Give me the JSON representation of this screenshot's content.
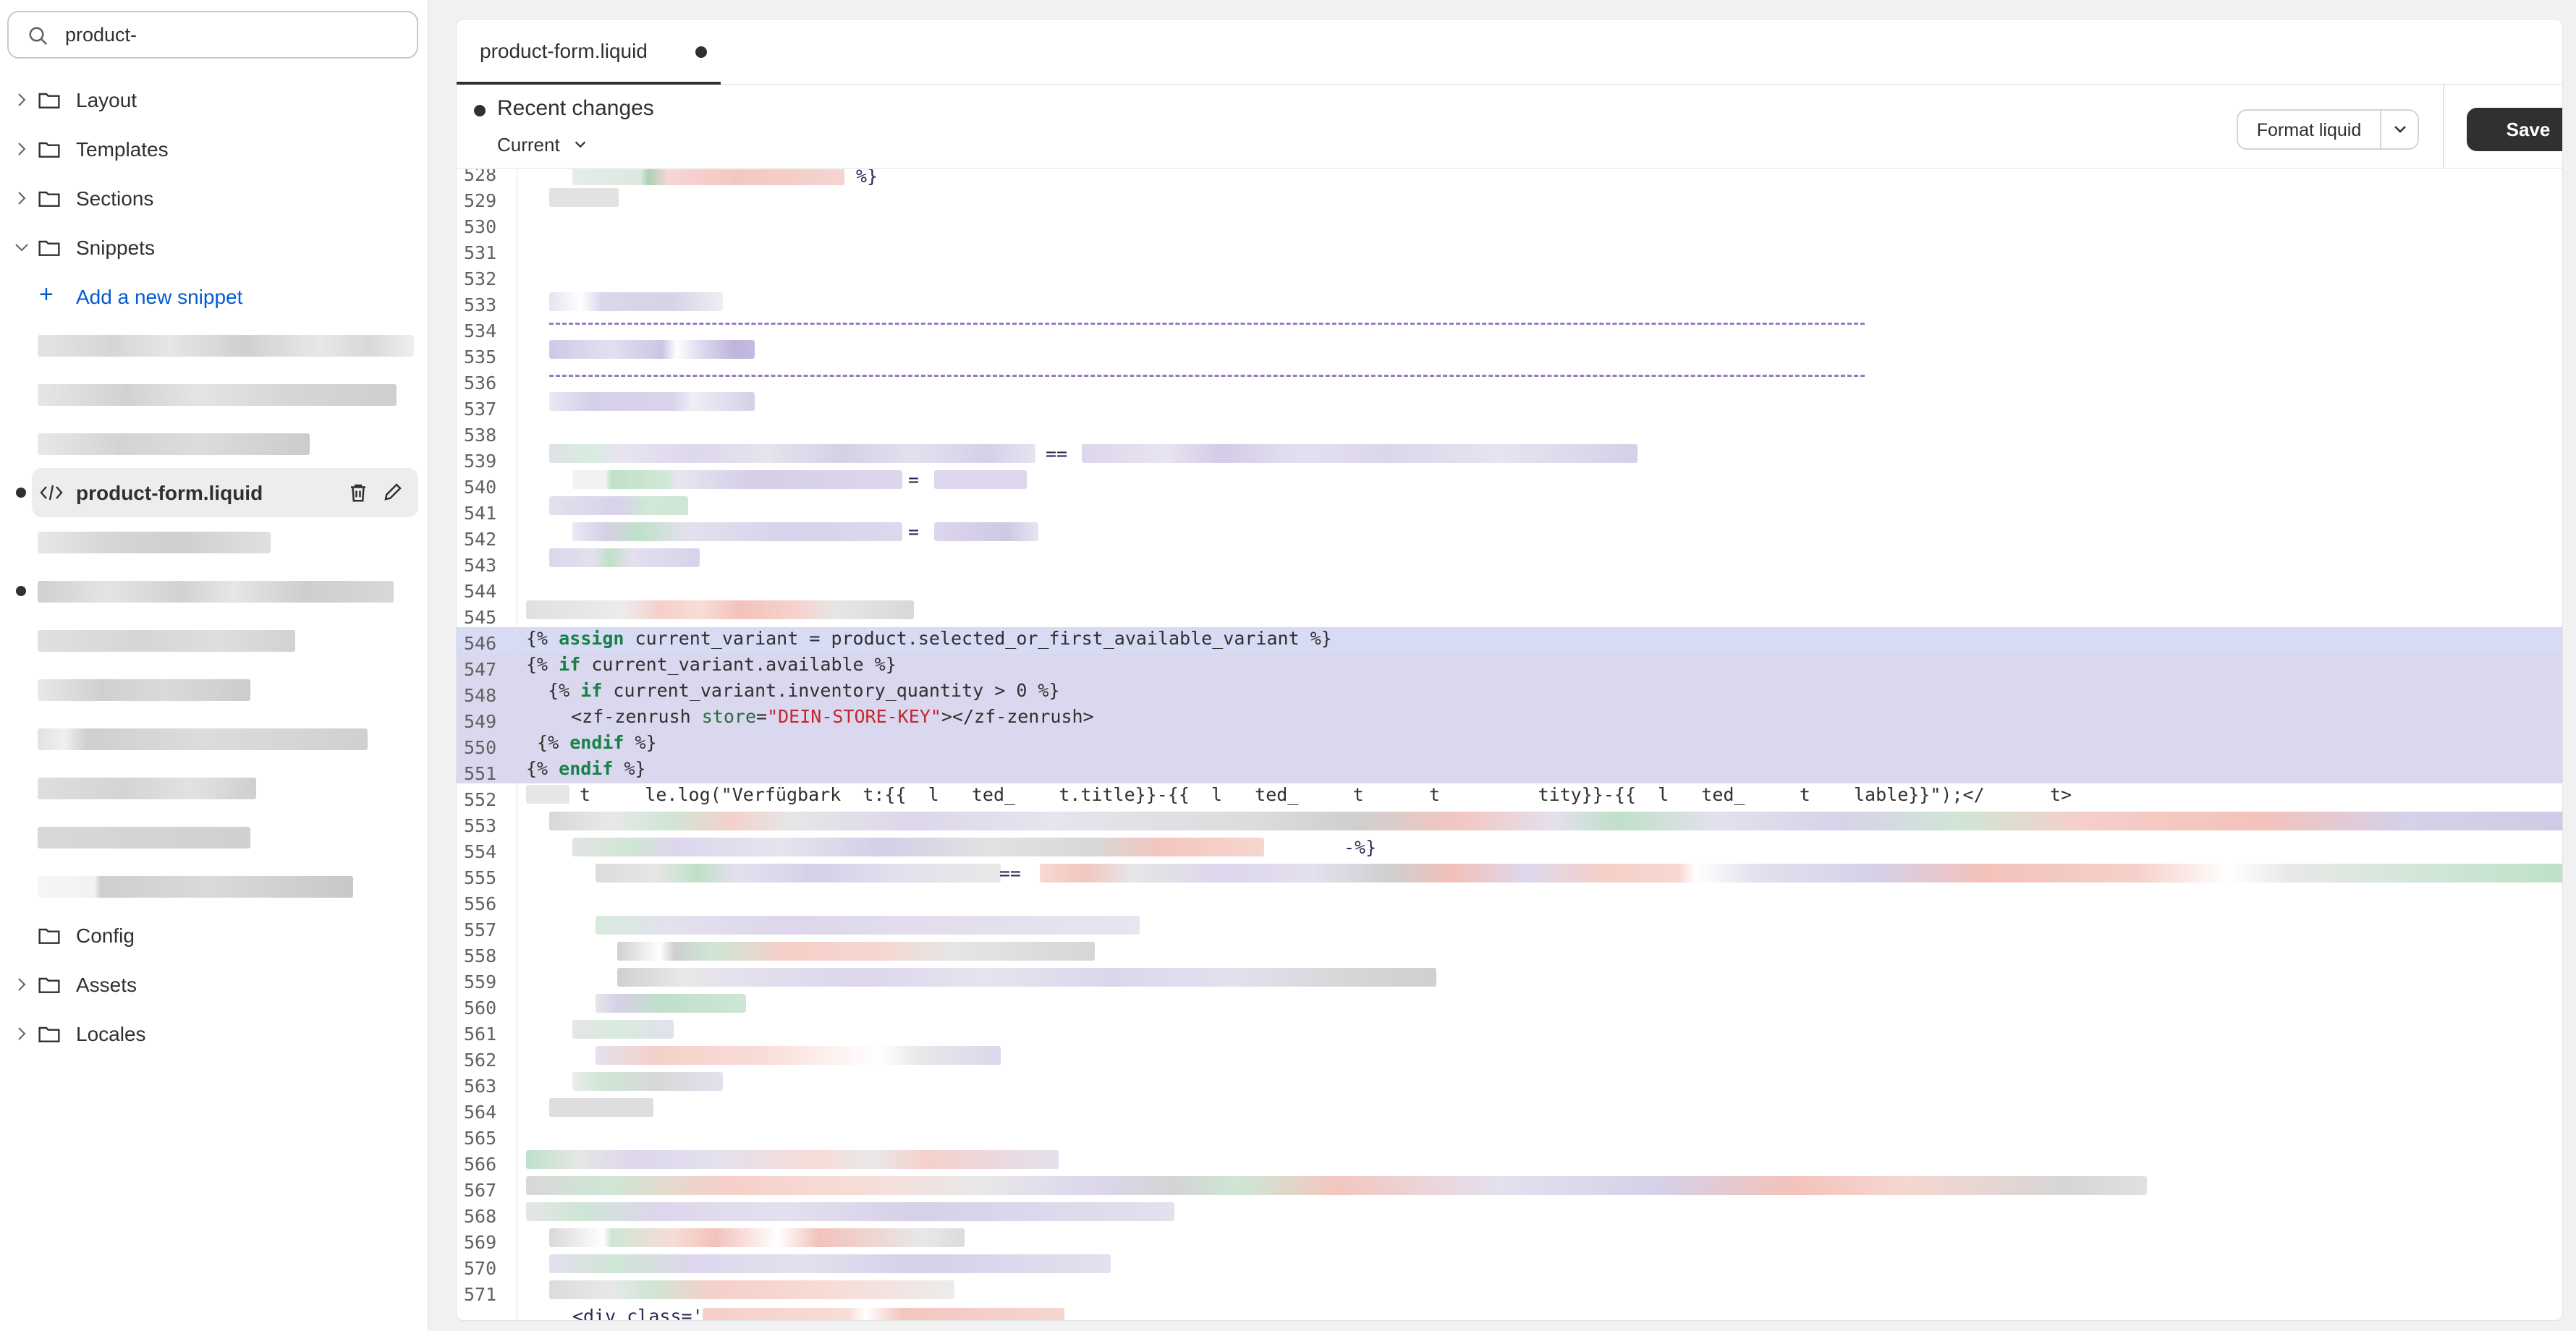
{
  "sidebar": {
    "search_value": "product-",
    "folders": [
      {
        "label": "Layout",
        "expanded": false
      },
      {
        "label": "Templates",
        "expanded": false
      },
      {
        "label": "Sections",
        "expanded": false
      },
      {
        "label": "Snippets",
        "expanded": true
      },
      {
        "label": "Config",
        "expanded": false
      },
      {
        "label": "Assets",
        "expanded": false
      },
      {
        "label": "Locales",
        "expanded": false
      }
    ],
    "add_snippet_label": "Add a new snippet",
    "active_file": "product-form.liquid"
  },
  "editor": {
    "tab_label": "product-form.liquid",
    "recent_changes_label": "Recent changes",
    "version_select": "Current",
    "format_button": "Format liquid",
    "save_button": "Save",
    "line_numbers": [
      "528",
      "529",
      "530",
      "531",
      "532",
      "533",
      "534",
      "535",
      "536",
      "537",
      "538",
      "539",
      "540",
      "541",
      "542",
      "543",
      "544",
      "545",
      "546",
      "547",
      "548",
      "549",
      "550",
      "551",
      "552",
      "553",
      "554",
      "555",
      "556",
      "557",
      "558",
      "559",
      "560",
      "561",
      "562",
      "563",
      "564",
      "565",
      "566",
      "567",
      "568",
      "569",
      "570",
      "571"
    ],
    "code": {
      "l545": "{% assign current_variant = product.selected_or_first_available_variant %}",
      "l546": "{% if current_variant.available %}",
      "l547": "  {% if current_variant.inventory_quantity > 0 %}",
      "l548_tag_open": "<zf-zenrush ",
      "l548_attr": "store",
      "l548_eq": "=",
      "l548_value": "\"DEIN-STORE-KEY\"",
      "l548_tag_close": "></zf-zenrush>",
      "l549": " {% endif %}",
      "l550": "{% endif %}",
      "l551": "t     le.log(\"Verfügbark  t:{{  l   ted_    t.title}}-{{  l   ted_     t      t         tity}}-{{  l   ted_     t    lable}}\");</      t>",
      "l528_tail": "%}",
      "l538_op": "==",
      "l539_op": "=",
      "l541_op": "=",
      "l553_tail": "-%}",
      "l554_op": "==",
      "l571": "<div class='"
    }
  }
}
